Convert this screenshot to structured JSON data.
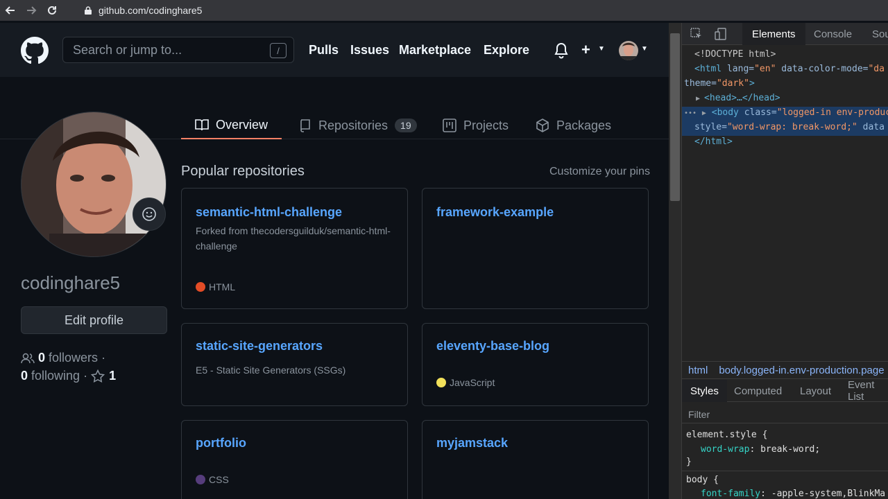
{
  "browser": {
    "url": "github.com/codinghare5"
  },
  "header": {
    "search_placeholder": "Search or jump to...",
    "search_key": "/",
    "nav": [
      "Pulls",
      "Issues",
      "Marketplace",
      "Explore"
    ],
    "plus": "+"
  },
  "tabs": {
    "overview": "Overview",
    "repositories": "Repositories",
    "repositories_count": "19",
    "projects": "Projects",
    "packages": "Packages"
  },
  "profile": {
    "username": "codinghare5",
    "edit_label": "Edit profile",
    "followers_count": "0",
    "followers_label": "followers",
    "sep": "·",
    "following_count": "0",
    "following_label": "following",
    "stars_count": "1"
  },
  "popular": {
    "title": "Popular repositories",
    "customize": "Customize your pins",
    "repos": [
      {
        "name": "semantic-html-challenge",
        "desc": "Forked from thecodersguilduk/semantic-html-challenge",
        "lang": "HTML",
        "color": "#e34c26"
      },
      {
        "name": "framework-example",
        "desc": "",
        "lang": "",
        "color": ""
      },
      {
        "name": "static-site-generators",
        "desc": "E5 - Static Site Generators (SSGs)",
        "lang": "",
        "color": ""
      },
      {
        "name": "eleventy-base-blog",
        "desc": "",
        "lang": "JavaScript",
        "color": "#f1e05a"
      },
      {
        "name": "portfolio",
        "desc": "",
        "lang": "CSS",
        "color": "#563d7c"
      },
      {
        "name": "myjamstack",
        "desc": "",
        "lang": "",
        "color": ""
      }
    ]
  },
  "devtools": {
    "tabs": [
      "Elements",
      "Console",
      "Sou"
    ],
    "dom": {
      "doctype": "<!DOCTYPE html>",
      "html_open": "<html",
      "lang_attr": " lang=",
      "lang_val": "\"en\"",
      "cm_attr": " data-color-mode=",
      "cm_val": "\"da",
      "theme_attr": "theme=",
      "theme_val": "\"dark\"",
      "theme_end": ">",
      "head": "<head>…</head>",
      "body_open": "<body",
      "body_class_attr": " class=",
      "body_class_val": "\"logged-in env-product",
      "style_attr": "style=",
      "style_val": "\"word-wrap: break-word;\"",
      "style_more": " data",
      "html_close": "</html>",
      "ellipsis": "•••"
    },
    "breadcrumb": [
      "html",
      "body.logged-in.env-production.page"
    ],
    "styles_tabs": [
      "Styles",
      "Computed",
      "Layout",
      "Event List"
    ],
    "filter": "Filter",
    "rules": {
      "element_style": "element.style {",
      "prop1": "word-wrap",
      "val1": "break-word;",
      "close1": "}",
      "body_sel": "body {",
      "prop2": "font-family",
      "val2": "-apple-system,BlinkMa"
    }
  },
  "colors": {
    "accent": "#58a6ff",
    "tab_underline": "#f78166"
  }
}
